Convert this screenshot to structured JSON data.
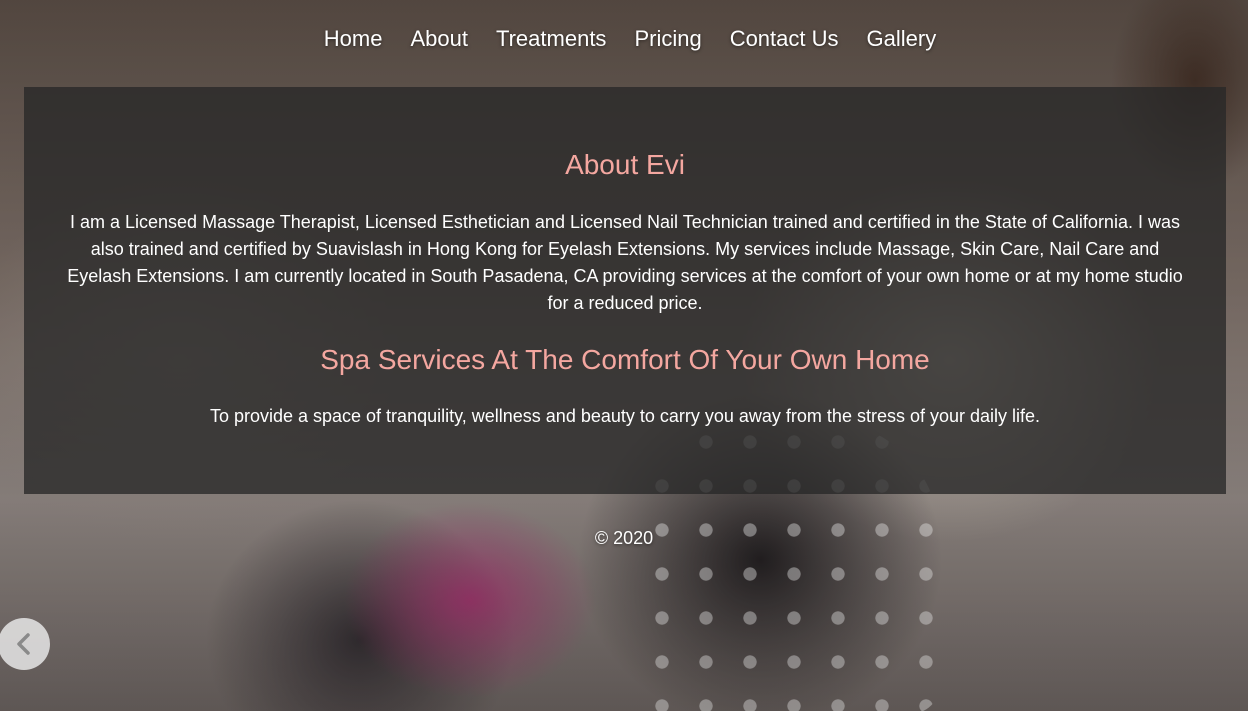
{
  "nav": {
    "items": [
      {
        "label": "Home"
      },
      {
        "label": "About"
      },
      {
        "label": "Treatments"
      },
      {
        "label": "Pricing"
      },
      {
        "label": "Contact Us"
      },
      {
        "label": "Gallery"
      }
    ]
  },
  "about": {
    "title": "About Evi",
    "bio": "I am a Licensed Massage Therapist, Licensed Esthetician and Licensed Nail Technician trained and certified in the State of California. I was also trained and certified by Suavislash in Hong Kong for Eyelash Extensions. My services include Massage, Skin Care, Nail Care and Eyelash Extensions. I am currently located in South Pasadena, CA providing services at the comfort of your own home or at my home studio for a reduced price.",
    "subtitle": "Spa Services At The Comfort Of Your Own Home",
    "mission": "To provide a space of tranquility, wellness and beauty to carry you away from the stress of your daily life."
  },
  "footer": {
    "copyright": "© 2020"
  },
  "slider": {
    "prev_icon": "chevron-left-icon"
  },
  "colors": {
    "heading_accent": "#f4a7a0",
    "panel_overlay": "rgba(40,40,40,0.78)",
    "text": "#ffffff"
  }
}
